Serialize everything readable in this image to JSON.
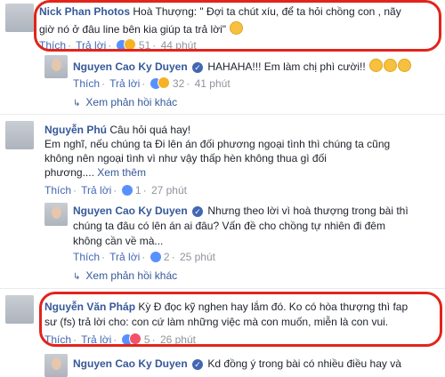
{
  "comments": [
    {
      "name": "Nick Phan Photos",
      "text_lines": [
        "Hoà Thượng: \" Đợi ta chút xíu, để ta hỏi chồng con , nãy",
        "giờ nó ở đâu line bên kia giúp ta trả lời\""
      ],
      "actions": {
        "like": "Thích",
        "reply": "Trả lời",
        "reactions": "51",
        "time": "44 phút"
      }
    },
    {
      "name": "Nguyen Cao Ky Duyen",
      "text_lines": [
        "HAHAHA!!! Em làm chị phì cười!!"
      ],
      "actions": {
        "like": "Thích",
        "reply": "Trả lời",
        "reactions": "32",
        "time": "41 phút"
      },
      "view_more": "Xem phản hồi khác"
    },
    {
      "name": "Nguyễn Phú",
      "text_lines": [
        "Câu hỏi quá hay!",
        "Em nghĩ, nếu chúng ta Đi lên án đối phương ngoại tình thì chúng ta cũng",
        "không nên ngoại tình vì như vậy thấp hèn không thua gì đối",
        "phương...."
      ],
      "see_more": "Xem thêm",
      "actions": {
        "like": "Thích",
        "reply": "Trả lời",
        "reactions": "1",
        "time": "27 phút"
      }
    },
    {
      "name": "Nguyen Cao Ky Duyen",
      "text_lines": [
        "Nhưng theo lời vì hoà thượng trong bài thì",
        "chúng ta đâu có lên án ai đâu? Vấn đề cho chồng tự nhiên đi đêm",
        "không cần về mà..."
      ],
      "actions": {
        "like": "Thích",
        "reply": "Trả lời",
        "reactions": "2",
        "time": "25 phút"
      },
      "view_more": "Xem phản hồi khác"
    },
    {
      "name": "Nguyễn Văn Pháp",
      "text_lines": [
        "Kỳ Đ đọc kỹ nghen hay lắm đó. Ko có hòa thượng thì fap",
        "sư (fs) trả lời cho: con cứ làm những việc mà con muốn, miễn là con vui."
      ],
      "actions": {
        "like": "Thích",
        "reply": "Trả lời",
        "reactions": "5",
        "time": "26 phút"
      }
    },
    {
      "name": "Nguyen Cao Ky Duyen",
      "text_lines": [
        "Kd đồng ý trong bài có nhiều điều hay và"
      ]
    }
  ],
  "colors": {
    "highlight": "#e2241b",
    "name": "#365899",
    "link": "#4267b2",
    "meta": "#90949c"
  },
  "icons": [
    "verified-badge-icon",
    "like-reaction-icon",
    "haha-reaction-icon",
    "heart-reaction-icon",
    "emoji-icon",
    "reply-arrow-icon"
  ]
}
